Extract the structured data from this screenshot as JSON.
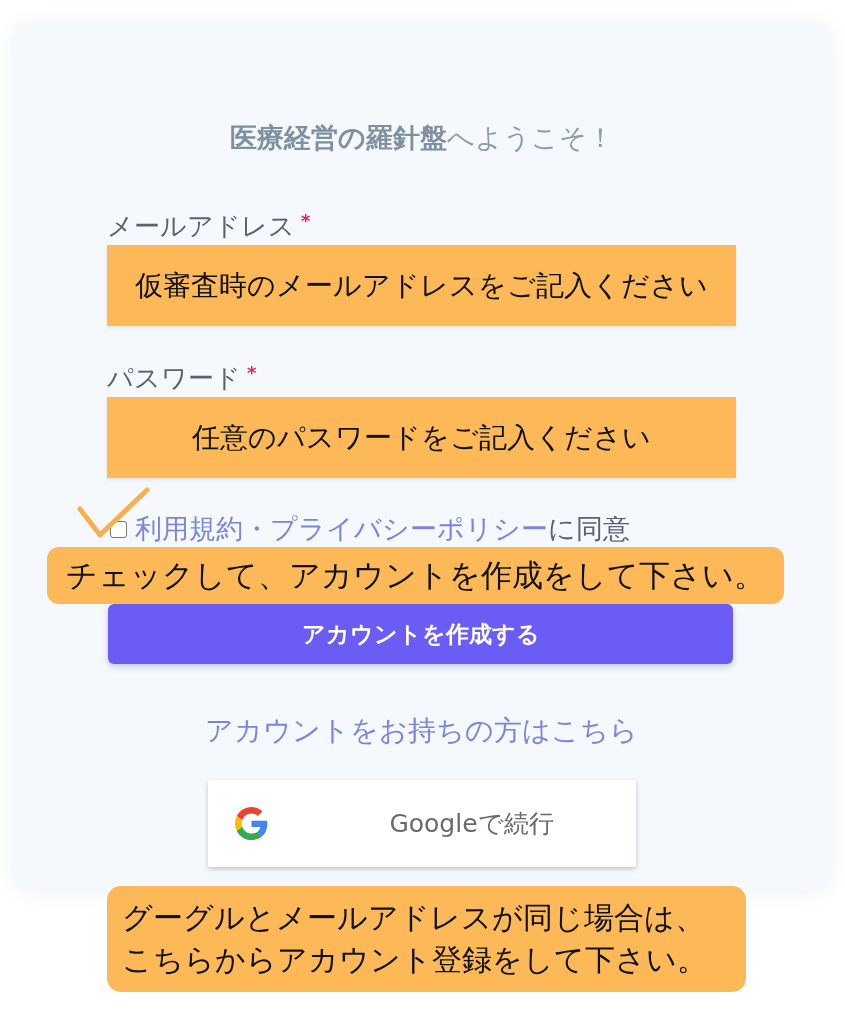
{
  "card": {
    "title": "**医療経営の羅針盤**へようこそ！",
    "fields": [
      {
        "label": "メールアドレス",
        "required_mark": "*",
        "note": "仮審査時のメールアドレスをご記入ください"
      },
      {
        "label": "パスワード",
        "required_mark": "*",
        "note": "任意のパスワードをご記入ください"
      }
    ],
    "agreement": {
      "checked": false,
      "link": "利用規約・プライバシーポリシー",
      "text": "に同意",
      "note": "チェックして、アカウントを作成をして下さい。"
    },
    "submit_button": "アカウントを作成する",
    "login_link": "アカウントをお持ちの方はこちら",
    "google_button": "Googleで続行"
  },
  "bottom_note": [
    "グーグルとメールアドレスが同じ場合は、",
    "こちらからアカウント登録をして下さい。"
  ]
}
